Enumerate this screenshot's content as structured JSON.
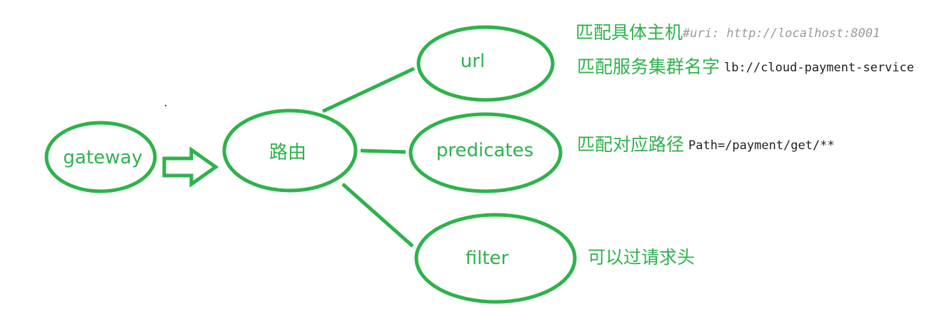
{
  "colors": {
    "accent": "#2db34a",
    "code": "#222222",
    "comment": "#9a9a9a"
  },
  "nodes": {
    "gateway": "gateway",
    "route": "路由",
    "url": "url",
    "predicates": "predicates",
    "filter": "filter"
  },
  "notes": {
    "url_host": {
      "text": "匹配具体主机",
      "comment": "#uri: http://localhost:8001"
    },
    "url_lb": {
      "text": "匹配服务集群名字",
      "code": "lb://cloud-payment-service"
    },
    "predicates": {
      "text": "匹配对应路径",
      "code": "Path=/payment/get/**"
    },
    "filter": {
      "text": "可以过请求头"
    }
  }
}
